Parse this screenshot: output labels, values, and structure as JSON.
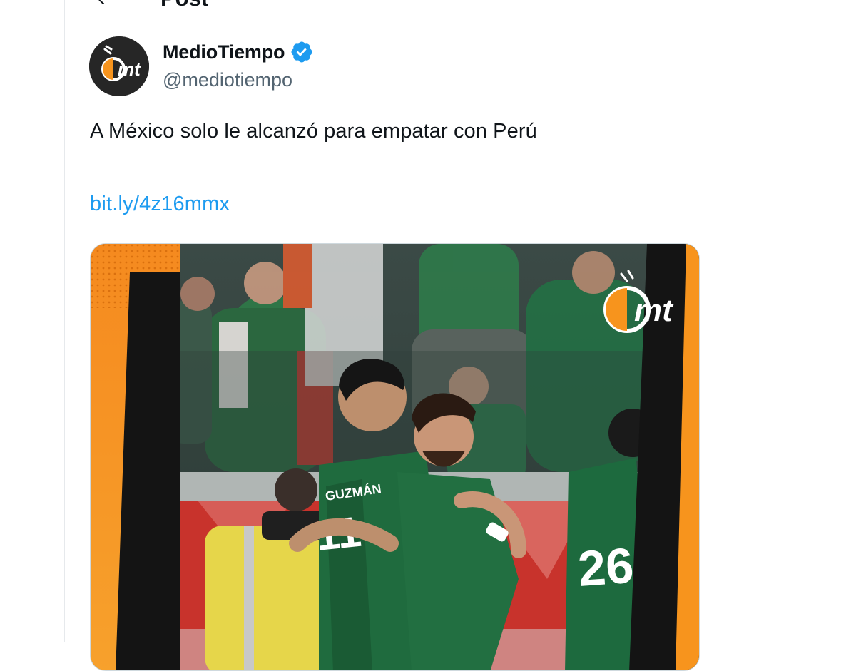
{
  "header": {
    "title": "Post",
    "back_icon": "arrow-left-icon"
  },
  "post": {
    "author": {
      "display_name": "MedioTiempo",
      "handle": "@mediotiempo",
      "avatar_text": "mt",
      "verified_icon": "verified-badge-icon",
      "verified_color": "#1d9bf0"
    },
    "text": "A México solo le alcanzó para empatar con Perú",
    "link": "bit.ly/4z16mmx",
    "media": {
      "watermark_text": "mt",
      "accent_color": "#f7941d",
      "frame_color": "#141414"
    }
  },
  "colors": {
    "link": "#1d9bf0",
    "secondary_text": "#536471",
    "jersey_green": "#1f6b3e"
  }
}
